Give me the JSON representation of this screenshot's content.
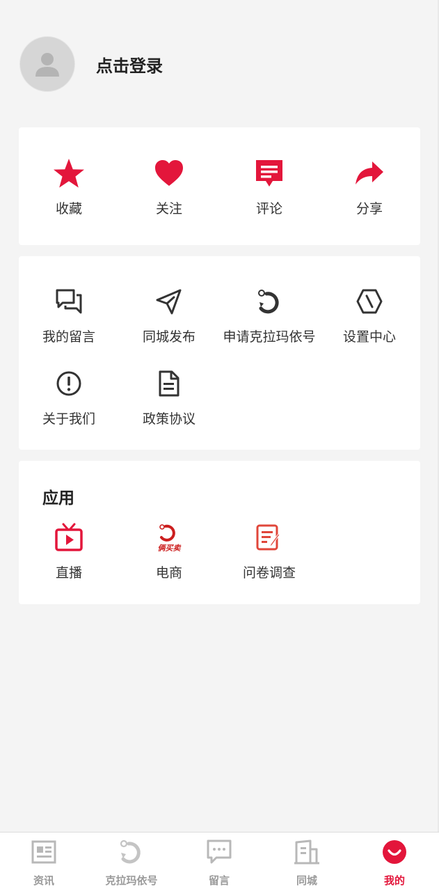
{
  "profile": {
    "login_label": "点击登录"
  },
  "quick_actions": [
    {
      "label": "收藏",
      "icon": "star-icon"
    },
    {
      "label": "关注",
      "icon": "heart-icon"
    },
    {
      "label": "评论",
      "icon": "comment-icon"
    },
    {
      "label": "分享",
      "icon": "share-icon"
    }
  ],
  "services": [
    {
      "label": "我的留言",
      "icon": "chat-bubbles-icon"
    },
    {
      "label": "同城发布",
      "icon": "send-arrow-icon"
    },
    {
      "label": "申请克拉玛依号",
      "icon": "karamay-logo-icon"
    },
    {
      "label": "设置中心",
      "icon": "hexagon-settings-icon"
    },
    {
      "label": "关于我们",
      "icon": "info-circle-icon"
    },
    {
      "label": "政策协议",
      "icon": "document-icon"
    }
  ],
  "apps": {
    "title": "应用",
    "items": [
      {
        "label": "直播",
        "icon": "tv-live-icon"
      },
      {
        "label": "电商",
        "icon": "ecommerce-logo-icon",
        "logo_text": "俩买卖"
      },
      {
        "label": "问卷调查",
        "icon": "survey-edit-icon"
      }
    ]
  },
  "tabbar": {
    "items": [
      {
        "label": "资讯",
        "icon": "news-icon",
        "active": false
      },
      {
        "label": "克拉玛依号",
        "icon": "karamay-logo-icon",
        "active": false
      },
      {
        "label": "留言",
        "icon": "message-icon",
        "active": false
      },
      {
        "label": "同城",
        "icon": "city-building-icon",
        "active": false
      },
      {
        "label": "我的",
        "icon": "smile-profile-icon",
        "active": true
      }
    ]
  },
  "colors": {
    "accent": "#e3163b",
    "background": "#f4f4f4",
    "card": "#ffffff",
    "inactive": "#9a9a9a"
  }
}
